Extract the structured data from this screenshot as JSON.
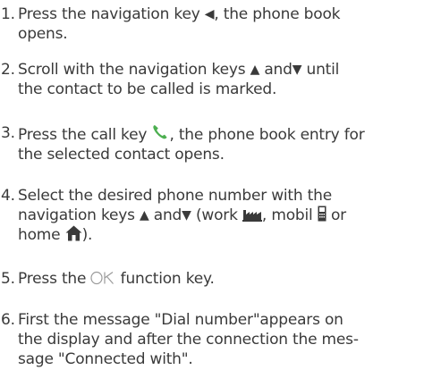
{
  "steps": [
    {
      "number": "1.",
      "parts": {
        "a": "Press the navigation key ",
        "b": ", the phone book",
        "c": "opens."
      }
    },
    {
      "number": "2.",
      "parts": {
        "a": "Scroll with the navigation keys ",
        "b": " and",
        "c": " until",
        "d": "the contact to be called is marked."
      }
    },
    {
      "number": "3.",
      "parts": {
        "a": "Press the call key ",
        "b": ", the phone book entry for",
        "c": "the selected contact opens."
      }
    },
    {
      "number": "4.",
      "parts": {
        "a": "Select the desired phone number with the",
        "b": "navigation keys ",
        "c": " and",
        "d": " (work ",
        "e": ", mobil ",
        "f": " or",
        "g": "home ",
        "h": ")."
      }
    },
    {
      "number": "5.",
      "parts": {
        "a": "Press the ",
        "b": " function key."
      }
    },
    {
      "number": "6.",
      "parts": {
        "a": "First the message \"Dial number\"appears on",
        "b": "the display and after the connection the mes-",
        "c": "sage \"Connected with\"."
      }
    }
  ],
  "icons": {
    "nav_left": "navigation-left-key-icon",
    "nav_up": "navigation-up-key-icon",
    "nav_down": "navigation-down-key-icon",
    "call": "call-key-icon",
    "work": "work-number-icon",
    "mobile": "mobile-number-icon",
    "home": "home-number-icon",
    "ok": "ok-function-key-icon"
  },
  "colors": {
    "text": "#3a3a3a",
    "call_key": "#4caf50"
  }
}
